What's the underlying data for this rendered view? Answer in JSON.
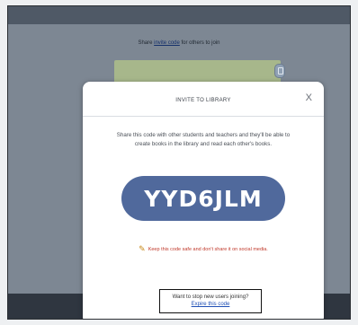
{
  "background": {
    "share_prefix": "Share",
    "share_link": "invite code",
    "share_suffix": "for others to join"
  },
  "modal": {
    "title": "INVITE TO LIBRARY",
    "close_label": "X",
    "description": "Share this code with other students and teachers and they'll be able to create books in the library and read each other's books.",
    "code": "YYD6JLM",
    "warning_icon": "pencil-icon",
    "warning": "Keep this code safe and don't share it on social media.",
    "stop_question": "Want to stop new users joining?",
    "expire_link": "Expire this code"
  },
  "colors": {
    "code_pill": "#50699c",
    "warning_text": "#c0392b",
    "link": "#1f4fb5"
  }
}
